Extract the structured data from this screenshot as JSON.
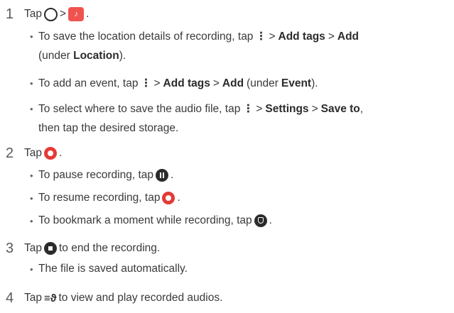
{
  "steps": [
    {
      "num": "1",
      "tap": "Tap",
      "sep": ">",
      "end": "."
    },
    {
      "num": "2",
      "tap": "Tap",
      "end": "."
    },
    {
      "num": "3",
      "tap": "Tap",
      "rest": "to end the recording."
    },
    {
      "num": "4",
      "tap": "Tap",
      "rest": "to view and play recorded audios."
    }
  ],
  "bullets": {
    "b1": {
      "pre": "To save the location details of recording, tap",
      "gt1": ">",
      "add_tags": "Add tags",
      "gt2": ">",
      "add": "Add",
      "cont_pre": "(under",
      "location": "Location",
      "cont_post": ")."
    },
    "b2": {
      "pre": "To add an event, tap",
      "gt1": ">",
      "add_tags": "Add tags",
      "gt2": ">",
      "add": "Add",
      "mid": "(under",
      "event": "Event",
      "post": ")."
    },
    "b3": {
      "pre": "To select where to save the audio file, tap",
      "gt1": ">",
      "settings": "Settings",
      "gt2": ">",
      "save_to": "Save to",
      "post": ",",
      "cont": "then tap the desired storage."
    },
    "b4": {
      "pre": "To pause recording, tap",
      "post": "."
    },
    "b5": {
      "pre": "To resume recording, tap",
      "post": "."
    },
    "b6": {
      "pre": "To bookmark a moment while recording, tap",
      "post": "."
    },
    "b7": {
      "text": "The file is saved automatically."
    }
  },
  "icons": [
    "home-icon",
    "voice-recorder-app-icon",
    "more-options-icon",
    "record-icon",
    "pause-icon",
    "bookmark-icon",
    "stop-icon",
    "recordings-list-icon"
  ],
  "colors": {
    "record": "#e53935",
    "app": "#ef5350",
    "dark_icon": "#2b2b2b"
  }
}
